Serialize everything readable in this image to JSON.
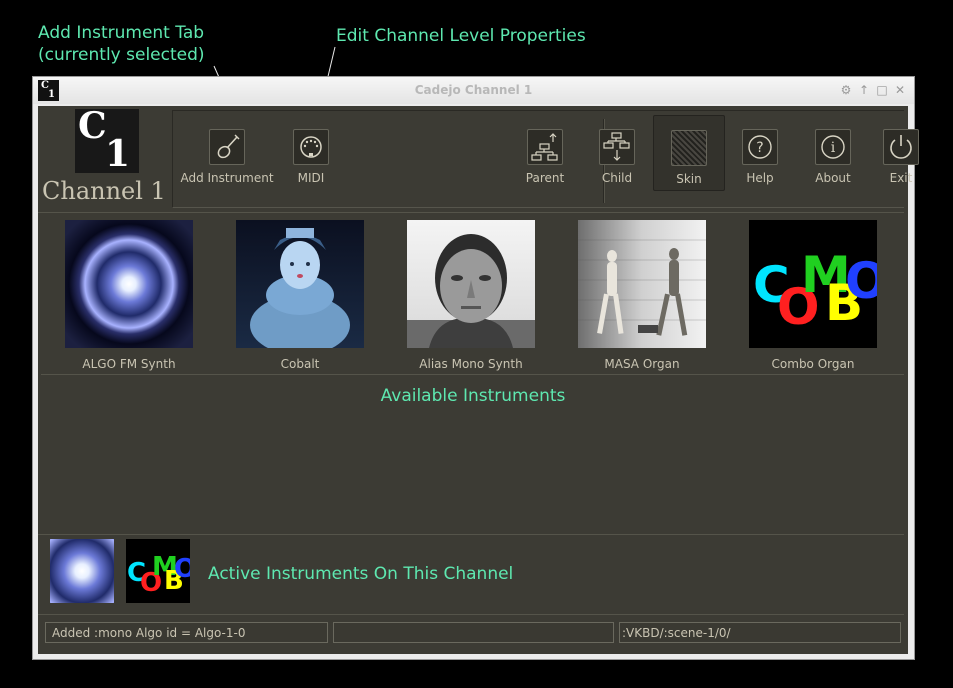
{
  "annotations": {
    "add_tab": [
      "Add Instrument Tab",
      "(currently selected)"
    ],
    "edit_channel": "Edit Channel Level Properties"
  },
  "window": {
    "title": "Cadejo Channel 1",
    "title_icon": {
      "c": "C",
      "n": "1"
    }
  },
  "channel": {
    "logo": {
      "c": "C",
      "n": "1"
    },
    "label": "Channel 1"
  },
  "toolbar": {
    "buttons": [
      {
        "label": "Add Instrument",
        "icon": "violin-icon",
        "selected": true
      },
      {
        "label": "MIDI",
        "icon": "midi-connector-icon"
      },
      {
        "label": "Parent",
        "icon": "tree-parent-icon"
      },
      {
        "label": "Child",
        "icon": "tree-child-icon"
      },
      {
        "label": "Skin",
        "icon": "skin-pattern-icon"
      },
      {
        "label": "Help",
        "icon": "question-icon"
      },
      {
        "label": "About",
        "icon": "info-icon"
      },
      {
        "label": "Exit",
        "icon": "power-icon"
      }
    ]
  },
  "instruments": [
    {
      "name": "ALGO FM Synth"
    },
    {
      "name": "Cobalt"
    },
    {
      "name": "Alias Mono Synth"
    },
    {
      "name": "MASA Organ"
    },
    {
      "name": "Combo Organ"
    }
  ],
  "available_label": "Available Instruments",
  "active_label": "Active Instruments On This Channel",
  "combo_letters": [
    "C",
    "O",
    "M",
    "B",
    "O"
  ],
  "combo_colors": [
    "#00e5ff",
    "#ff2020",
    "#20d020",
    "#ffff00",
    "#2040ff"
  ],
  "status": {
    "message": "Added :mono Algo id = Algo-1-0",
    "middle": "",
    "path": ":VKBD/:scene-1/0/"
  },
  "colors": {
    "annotation": "#5ee8b0",
    "panel_bg": "#3c3b34",
    "text": "#c9c4b2"
  }
}
